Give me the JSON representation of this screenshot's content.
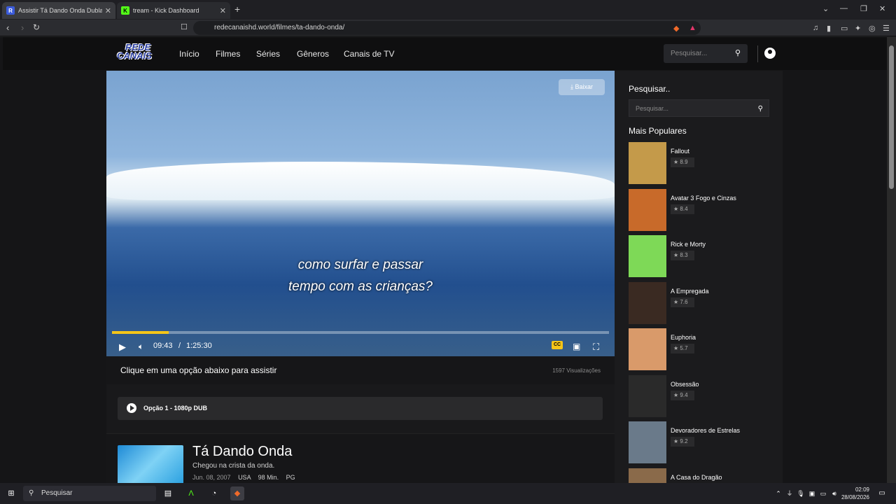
{
  "browser": {
    "tabs": [
      {
        "title": "Assistir Tá Dando Onda Dubla"
      },
      {
        "title": "tream - Kick Dashboard"
      }
    ],
    "new_tab": "+",
    "url": "redecanaishd.world/filmes/ta-dando-onda/"
  },
  "site": {
    "logo_line1": "REDE",
    "logo_line2": "CANAIS",
    "menu": [
      "Início",
      "Filmes",
      "Séries",
      "Gêneros",
      "Canais de TV"
    ],
    "header_search_placeholder": "Pesquisar...",
    "player": {
      "download_label": "Baixar",
      "subtitle_line1": "como surfar e passar",
      "subtitle_line2": "tempo com as crianças?",
      "current_time": "09:43",
      "separator": "/",
      "duration": "1:25:30",
      "progress_fraction": 0.114,
      "cc_label": "CC"
    },
    "watch_prompt": "Clique em uma opção abaixo para assistir",
    "views": "1597 Visualizações",
    "option_label": "Opção 1 - 1080p DUB",
    "movie": {
      "title": "Tá Dando Onda",
      "tagline": "Chegou na crista da onda.",
      "date": "Jun. 08, 2007",
      "country": "USA",
      "runtime": "98 Min.",
      "rating": "PG"
    },
    "sidebar": {
      "search_title": "Pesquisar..",
      "search_placeholder": "Pesquisar...",
      "popular_title": "Mais Populares",
      "popular": [
        {
          "name": "Fallout",
          "score": "8.9"
        },
        {
          "name": "Avatar 3 Fogo e Cinzas",
          "score": "8.4"
        },
        {
          "name": "Rick e Morty",
          "score": "8.3"
        },
        {
          "name": "A Empregada",
          "score": "7.6"
        },
        {
          "name": "Euphoria",
          "score": "5.7"
        },
        {
          "name": "Obsessão",
          "score": "9.4"
        },
        {
          "name": "Devoradores de Estrelas",
          "score": "9.2"
        },
        {
          "name": "A Casa do Dragão",
          "score": ""
        }
      ]
    }
  },
  "taskbar": {
    "search_placeholder": "Pesquisar",
    "time": "02:09",
    "date": "28/08/2026"
  },
  "colors": {
    "accent": "#f5c518",
    "page_bg": "#151517"
  }
}
